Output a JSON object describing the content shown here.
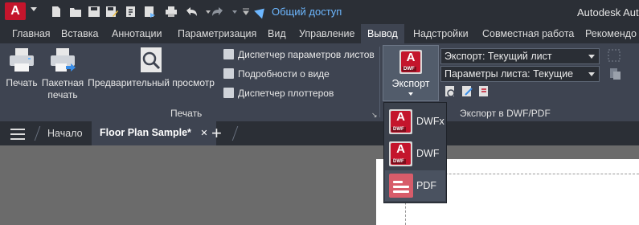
{
  "app": {
    "title": "Autodesk Auto",
    "logo_letter": "A",
    "share_label": "Общий доступ",
    "quick_access_icons": [
      "new-icon",
      "open-icon",
      "save-icon",
      "save-as-icon",
      "publish-icon",
      "print-icon",
      "undo-icon",
      "redo-icon",
      "customize-icon"
    ]
  },
  "ribbon_tabs": [
    "Главная",
    "Вставка",
    "Аннотации",
    "Параметризация",
    "Вид",
    "Управление",
    "Вывод",
    "Надстройки",
    "Совместная работа",
    "Рекомендо"
  ],
  "active_tab": "Вывод",
  "print_panel": {
    "print_label": "Печать",
    "batch_print_label_line1": "Пакетная",
    "batch_print_label_line2": "печать",
    "preview_label": "Предварительный просмотр",
    "small_buttons": [
      "Диспетчер параметров листов",
      "Подробности о виде",
      "Диспетчер плоттеров"
    ],
    "panel_title": "Печать"
  },
  "export_panel": {
    "export_label": "Экспорт",
    "export_combo_value": "Экспорт: Текущий лист",
    "page_setup_combo_value": "Параметры листа: Текущие",
    "panel_title": "Экспорт в DWF/PDF",
    "icon_letter": "A",
    "icon_tag": "DWF"
  },
  "export_menu": [
    {
      "label": "DWFx",
      "icon": "dwfx-icon",
      "tag": "DWF"
    },
    {
      "label": "DWF",
      "icon": "dwf-icon",
      "tag": "DWF"
    },
    {
      "label": "PDF",
      "icon": "pdf-icon"
    }
  ],
  "doc_tabs": {
    "home_label": "Начало",
    "active_label": "Floor Plan Sample*",
    "close_glyph": "✕",
    "new_tab_glyph": "+"
  },
  "colors": {
    "brand_red": "#c4152c",
    "link_blue": "#6db7ff",
    "ribbon_bg": "#3e4451",
    "titlebar_bg": "#2b2f36"
  }
}
